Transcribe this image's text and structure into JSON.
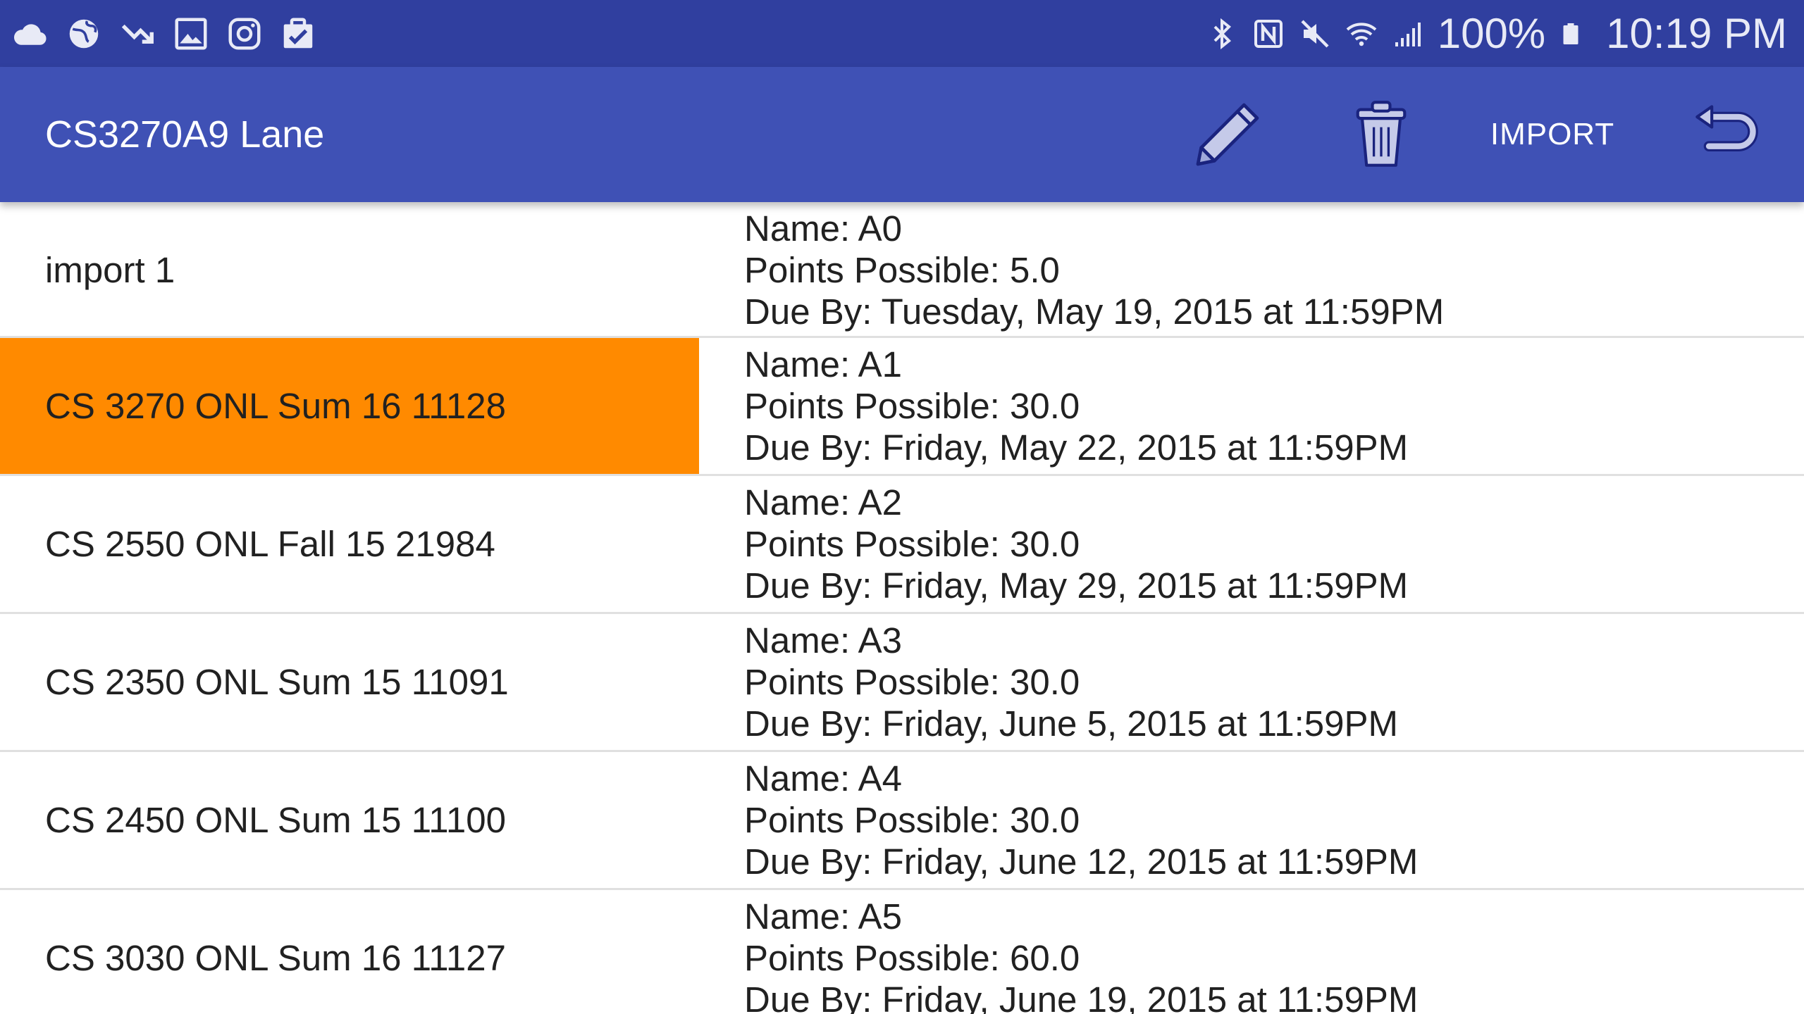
{
  "status_bar": {
    "left_icons": [
      "cloud-icon",
      "globe-icon",
      "missed-call-icon",
      "gallery-icon",
      "instagram-icon",
      "clipboard-check-icon"
    ],
    "right_icons": [
      "bluetooth-icon",
      "nfc-icon",
      "mute-icon",
      "wifi-icon",
      "signal-icon",
      "battery-icon"
    ],
    "battery": "100%",
    "time": "10:19 PM"
  },
  "app_bar": {
    "title": "CS3270A9 Lane",
    "edit_icon": "pencil-icon",
    "delete_icon": "trash-icon",
    "import_label": "IMPORT",
    "undo_icon": "undo-icon"
  },
  "courses": [
    {
      "name": "import 1",
      "selected": false
    },
    {
      "name": "CS 3270 ONL Sum 16 11128",
      "selected": true
    },
    {
      "name": "CS 2550 ONL Fall 15 21984",
      "selected": false
    },
    {
      "name": "CS 2350 ONL Sum 15 11091",
      "selected": false
    },
    {
      "name": "CS 2450 ONL Sum 15 11100",
      "selected": false
    },
    {
      "name": "CS 3030 ONL Sum 16 11127",
      "selected": false
    }
  ],
  "assignments": [
    {
      "name": "Name: A0",
      "points": "Points Possible: 5.0",
      "due": "Due By: Tuesday, May 19, 2015 at 11:59PM"
    },
    {
      "name": "Name: A1",
      "points": "Points Possible: 30.0",
      "due": "Due By: Friday, May 22, 2015 at 11:59PM"
    },
    {
      "name": "Name: A2",
      "points": "Points Possible: 30.0",
      "due": "Due By: Friday, May 29, 2015 at 11:59PM"
    },
    {
      "name": "Name: A3",
      "points": "Points Possible: 30.0",
      "due": "Due By: Friday, June 5, 2015 at 11:59PM"
    },
    {
      "name": "Name: A4",
      "points": "Points Possible: 30.0",
      "due": "Due By: Friday, June 12, 2015 at 11:59PM"
    },
    {
      "name": "Name: A5",
      "points": "Points Possible: 60.0",
      "due": "Due By: Friday, June 19, 2015 at 11:59PM"
    }
  ],
  "colors": {
    "status_bar": "#303f9f",
    "app_bar": "#3f51b5",
    "selected_row": "#ff8a00",
    "divider": "#e0e0e0"
  }
}
